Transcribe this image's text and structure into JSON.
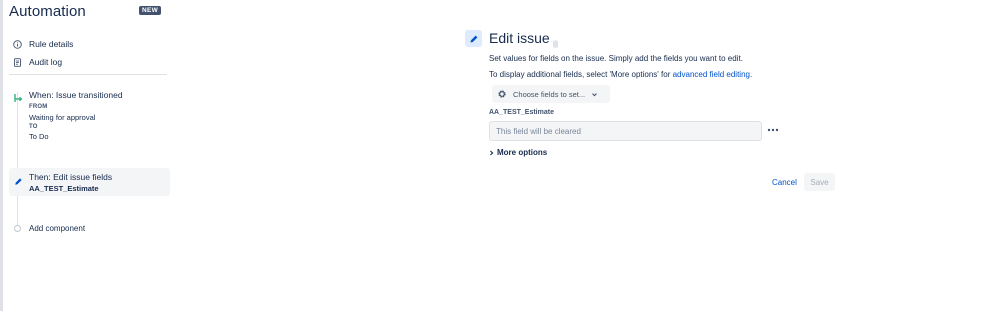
{
  "app": {
    "title": "Automation",
    "badge": "NEW"
  },
  "sidebar": {
    "nav": [
      {
        "label": "Rule details",
        "icon": "info-icon"
      },
      {
        "label": "Audit log",
        "icon": "document-icon"
      }
    ],
    "trigger": {
      "title": "When: Issue transitioned",
      "from_label": "FROM",
      "from_value": "Waiting for approval",
      "to_label": "TO",
      "to_value": "To Do",
      "icon": "transition-icon"
    },
    "action": {
      "title": "Then: Edit issue fields",
      "subtitle": "AA_TEST_Estimate",
      "icon": "pencil-icon"
    },
    "add_component": "Add component"
  },
  "main": {
    "title": "Edit issue",
    "description_line1": "Set values for fields on the issue. Simply add the fields you want to edit.",
    "description_line2_prefix": "To display additional fields, select 'More options' for ",
    "description_line2_link": "advanced field editing",
    "description_line2_suffix": ".",
    "choose_fields_label": "Choose fields to set...",
    "field": {
      "label": "AA_TEST_Estimate",
      "placeholder": "This field will be cleared",
      "value": ""
    },
    "more_options_label": "More options",
    "cancel_label": "Cancel",
    "save_label": "Save"
  },
  "colors": {
    "link": "#0052cc",
    "text": "#172b4d",
    "subtle": "#42526e",
    "badge_bg": "#42526e",
    "selected_bg": "#f4f5f7",
    "icon_bg": "#deebff",
    "trigger_icon": "#36b37e"
  }
}
